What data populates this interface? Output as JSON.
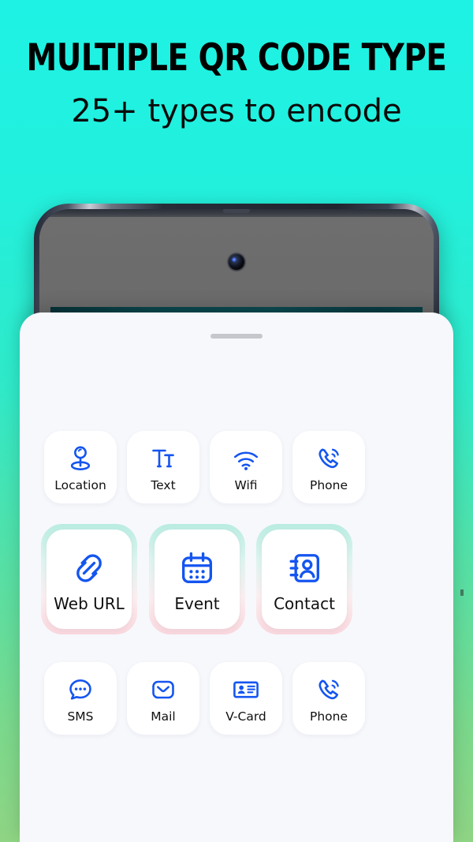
{
  "header": {
    "headline": "MULTIPLE QR CODE TYPE",
    "subline": "25+ types to encode"
  },
  "theme": {
    "bg_top": "#1ef2e4",
    "bg_bottom": "#8fd484",
    "icon_blue": "#1455f0",
    "sheet_bg": "#f6f8fc",
    "card_bg": "#ffffff",
    "label_color": "#101010",
    "halo_top": "#b9ece1",
    "halo_bottom": "#f9d7dd",
    "phone_screen": "#6b6b6b",
    "phone_band": "#0b4a50",
    "handle_color": "#c5c7cc"
  },
  "sheet": {
    "handle": "drag-handle",
    "rows": [
      {
        "size": "small",
        "items": [
          {
            "label": "Location",
            "icon": "location-pin-icon"
          },
          {
            "label": "Text",
            "icon": "text-tt-icon"
          },
          {
            "label": "Wifi",
            "icon": "wifi-icon"
          },
          {
            "label": "Phone",
            "icon": "phone-call-icon"
          }
        ]
      },
      {
        "size": "big",
        "items": [
          {
            "label": "Web URL",
            "icon": "link-chain-icon"
          },
          {
            "label": "Event",
            "icon": "calendar-icon"
          },
          {
            "label": "Contact",
            "icon": "contact-book-icon"
          }
        ]
      },
      {
        "size": "small",
        "items": [
          {
            "label": "SMS",
            "icon": "chat-bubble-icon"
          },
          {
            "label": "Mail",
            "icon": "envelope-icon"
          },
          {
            "label": "V-Card",
            "icon": "id-card-icon"
          },
          {
            "label": "Phone",
            "icon": "phone-call-icon"
          }
        ]
      }
    ]
  },
  "phone_mockup": {
    "camera": "front-camera",
    "speaker": "earpiece-speaker"
  }
}
